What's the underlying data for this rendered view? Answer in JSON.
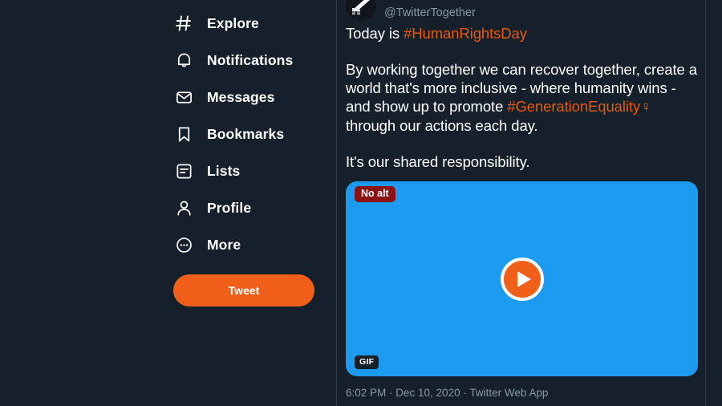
{
  "sidebar": {
    "items": [
      {
        "label": "Explore",
        "icon": "hashtag-icon"
      },
      {
        "label": "Notifications",
        "icon": "bell-icon"
      },
      {
        "label": "Messages",
        "icon": "envelope-icon"
      },
      {
        "label": "Bookmarks",
        "icon": "bookmark-icon"
      },
      {
        "label": "Lists",
        "icon": "list-icon"
      },
      {
        "label": "Profile",
        "icon": "person-icon"
      },
      {
        "label": "More",
        "icon": "ellipsis-circle-icon"
      }
    ],
    "tweet_button": "Tweet"
  },
  "tweet": {
    "handle": "@TwitterTogether",
    "line1_prefix": "Today is ",
    "line1_hashtag": "#HumanRightsDay",
    "para2_a": "By working together we can recover together, create a world that's more inclusive - where humanity wins - and show up to promote ",
    "para2_hashtag": "#GenerationEquality",
    "para2_symbol": "♀",
    "para2_b": " through our actions each day.",
    "para3": "It's our shared responsibility.",
    "media": {
      "no_alt_badge": "No alt",
      "gif_badge": "GIF",
      "play_label": "play-button"
    },
    "meta": "6:02 PM · Dec 10, 2020 · Twitter Web App"
  },
  "colors": {
    "background": "#15202b",
    "accent_orange": "#f0601a",
    "hashtag_orange": "#e8590c",
    "media_blue": "#1d9bf0",
    "no_alt_red": "#8b1113",
    "muted_text": "#8899a6",
    "divider": "#31404e"
  }
}
